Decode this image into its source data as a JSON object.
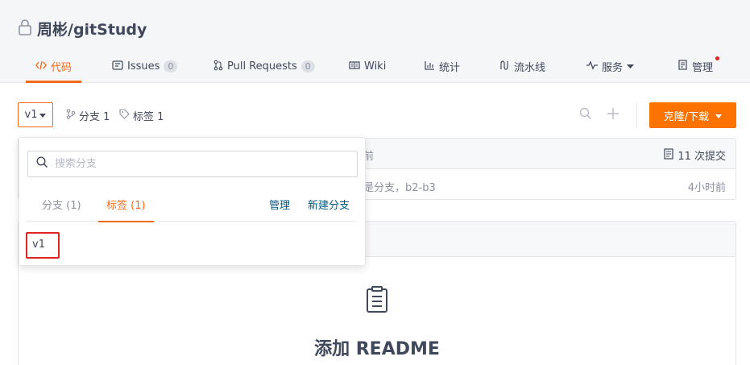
{
  "repo": {
    "title": "周彬/gitStudy"
  },
  "nav": {
    "tabs": [
      {
        "label": "代码"
      },
      {
        "label": "Issues",
        "count": "0"
      },
      {
        "label": "Pull Requests",
        "count": "0"
      },
      {
        "label": "Wiki"
      },
      {
        "label": "统计"
      },
      {
        "label": "流水线"
      },
      {
        "label": "服务"
      },
      {
        "label": "管理"
      }
    ]
  },
  "ref": {
    "current": "v1",
    "branches_label": "分支 1",
    "tags_label": "标签 1"
  },
  "actions": {
    "clone_label": "克隆/下载"
  },
  "commits": {
    "count_label": "11 次提交",
    "partial_head": "前",
    "partial_message": "是分支，b2-b3",
    "time": "4小时前"
  },
  "readme": {
    "title": "添加 README"
  },
  "dropdown": {
    "search_placeholder": "搜索分支",
    "tab_branches": "分支 (1)",
    "tab_tags": "标签 (1)",
    "manage_label": "管理",
    "new_branch_label": "新建分支",
    "items": [
      "v1"
    ]
  },
  "colors": {
    "accent": "#f26b1d",
    "button": "#fe7300",
    "highlight": "#e02424"
  }
}
